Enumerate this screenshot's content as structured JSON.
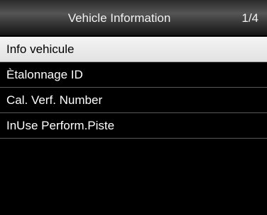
{
  "header": {
    "title": "Vehicle Information",
    "page_indicator": "1/4"
  },
  "menu": {
    "selected_index": 0,
    "items": [
      {
        "label": "Info vehicule"
      },
      {
        "label": "Ètalonnage ID"
      },
      {
        "label": "Cal. Verf. Number"
      },
      {
        "label": "InUse Perform.Piste"
      }
    ]
  }
}
